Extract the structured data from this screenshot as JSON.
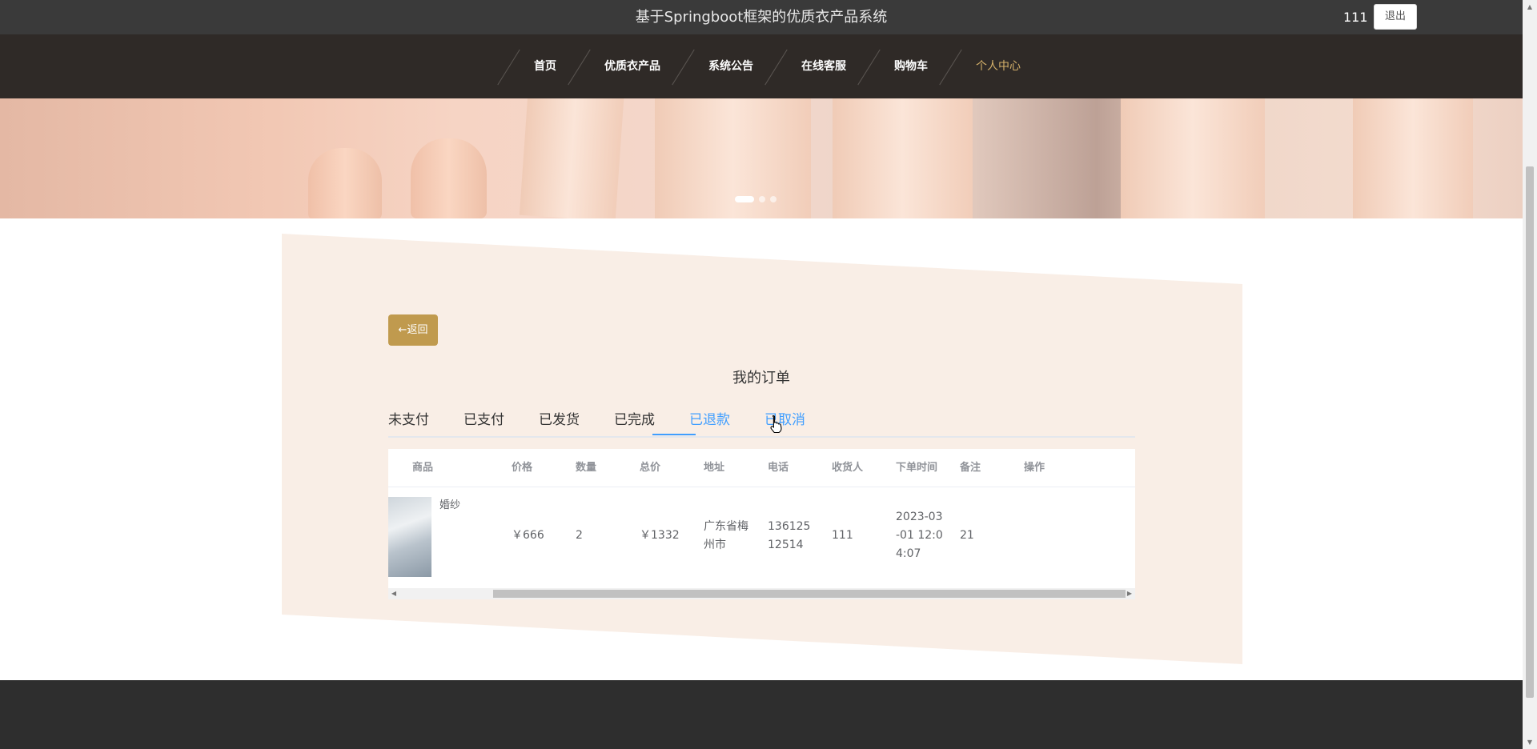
{
  "header": {
    "site_title": "基于Springboot框架的优质衣产品系统",
    "username": "111",
    "logout_label": "退出"
  },
  "nav": {
    "items": [
      {
        "label": "首页"
      },
      {
        "label": "优质衣产品"
      },
      {
        "label": "系统公告"
      },
      {
        "label": "在线客服"
      },
      {
        "label": "购物车"
      },
      {
        "label": "个人中心"
      }
    ],
    "active_index": 5,
    "active_color": "#d4b06a"
  },
  "banner": {
    "carousel_slides": 3,
    "active_slide": 0
  },
  "orders": {
    "back_label": "←返回",
    "title": "我的订单",
    "tabs": [
      {
        "label": "未支付"
      },
      {
        "label": "已支付"
      },
      {
        "label": "已发货"
      },
      {
        "label": "已完成"
      },
      {
        "label": "已退款"
      },
      {
        "label": "已取消"
      }
    ],
    "active_tab": 4,
    "columns": [
      "商品",
      "价格",
      "数量",
      "总价",
      "地址",
      "电话",
      "收货人",
      "下单时间",
      "备注",
      "操作"
    ],
    "rows": [
      {
        "product": "婚纱",
        "price": "￥666",
        "quantity": "2",
        "total": "￥1332",
        "address": "广东省梅州市",
        "phone": "13612512514",
        "receiver": "111",
        "order_time": "2023-03-01 12:04:07",
        "remark": "21",
        "actions": ""
      }
    ]
  },
  "colors": {
    "topbar": "#3a3a3a",
    "navbar": "#2f2a27",
    "accent_gold": "#c09a4e",
    "tab_active": "#409eff",
    "panel_bg": "#f9eee6",
    "footer": "#2e2e2e"
  }
}
